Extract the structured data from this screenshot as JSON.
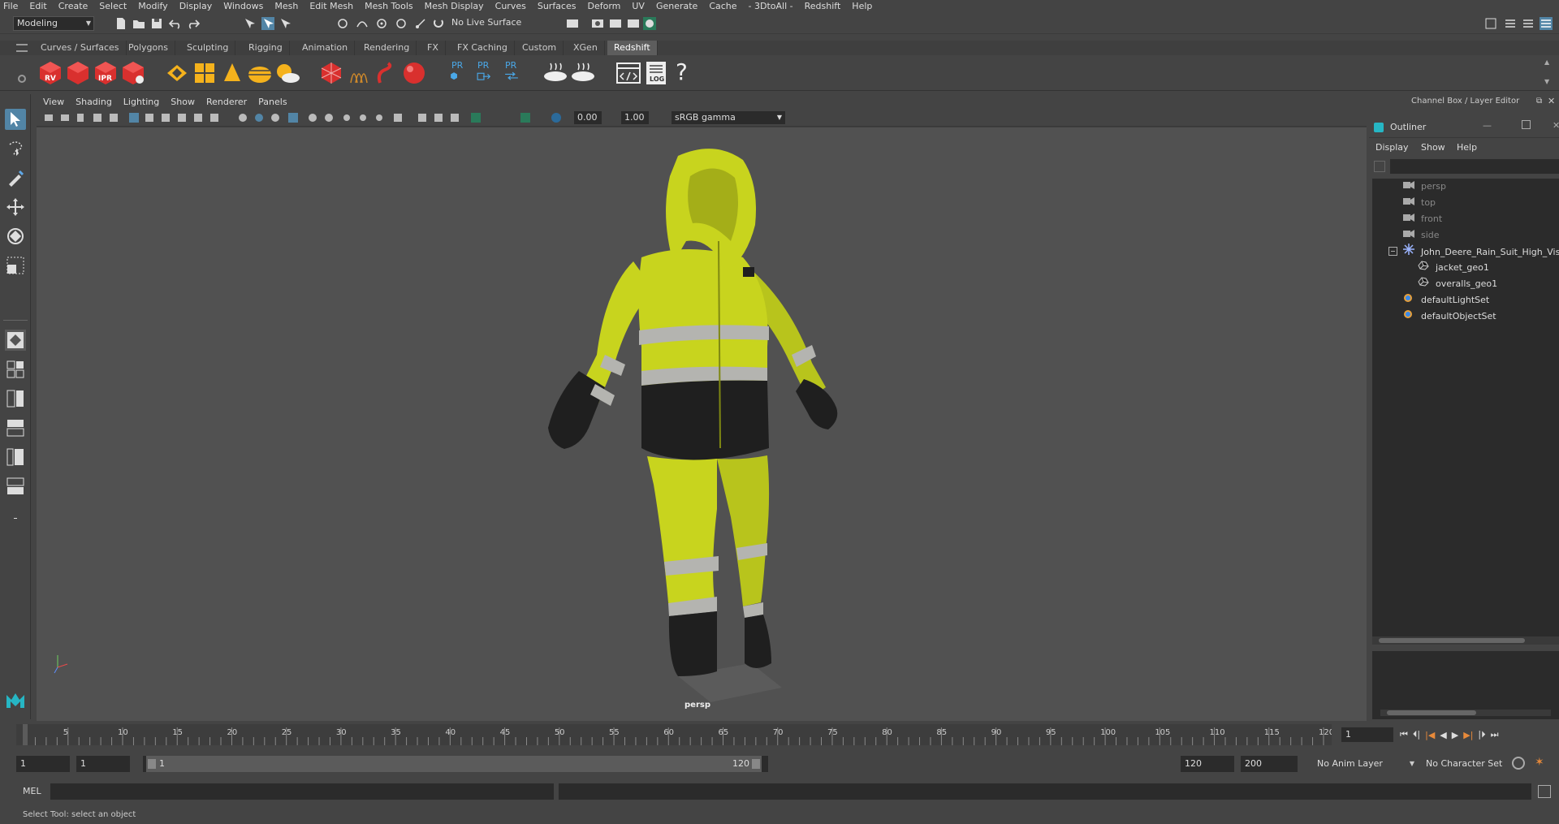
{
  "menubar": [
    "File",
    "Edit",
    "Create",
    "Select",
    "Modify",
    "Display",
    "Windows",
    "Mesh",
    "Edit Mesh",
    "Mesh Tools",
    "Mesh Display",
    "Curves",
    "Surfaces",
    "Deform",
    "UV",
    "Generate",
    "Cache",
    "- 3DtoAll -",
    "Redshift",
    "Help"
  ],
  "statusline": {
    "mode": "Modeling",
    "live_surface": "No Live Surface"
  },
  "shelf": {
    "tabs": [
      "Curves / Surfaces",
      "Polygons",
      "Sculpting",
      "Rigging",
      "Animation",
      "Rendering",
      "FX",
      "FX Caching",
      "Custom",
      "XGen",
      "Redshift"
    ],
    "active_tab": "Redshift",
    "icon_labels": {
      "rv": "RV",
      "ipr": "IPR",
      "log": "LOG",
      "help": "?",
      "pr1": "PR",
      "pr2": "PR",
      "pr3": "PR"
    }
  },
  "viewport": {
    "menu": [
      "View",
      "Shading",
      "Lighting",
      "Show",
      "Renderer",
      "Panels"
    ],
    "exposure": "0.00",
    "gamma": "1.00",
    "color_space": "sRGB gamma",
    "camera_label": "persp",
    "character_colors": {
      "hi_vis": "#c8d41e",
      "black": "#1f1f1f",
      "reflective": "#b4b4b0"
    }
  },
  "right_panel": {
    "header": "Channel Box / Layer Editor",
    "outliner_title": "Outliner",
    "outliner_menu": [
      "Display",
      "Show",
      "Help"
    ],
    "items": [
      {
        "label": "persp",
        "icon": "camera-icon",
        "dim": true,
        "indent": 1
      },
      {
        "label": "top",
        "icon": "camera-icon",
        "dim": true,
        "indent": 1
      },
      {
        "label": "front",
        "icon": "camera-icon",
        "dim": true,
        "indent": 1
      },
      {
        "label": "side",
        "icon": "camera-icon",
        "dim": true,
        "indent": 1
      },
      {
        "label": "John_Deere_Rain_Suit_High_Visib",
        "icon": "group-icon",
        "dim": false,
        "indent": 1
      },
      {
        "label": "jacket_geo1",
        "icon": "mesh-icon",
        "dim": false,
        "indent": 2
      },
      {
        "label": "overalls_geo1",
        "icon": "mesh-icon",
        "dim": false,
        "indent": 2
      },
      {
        "label": "defaultLightSet",
        "icon": "set-icon",
        "dim": false,
        "indent": 1
      },
      {
        "label": "defaultObjectSet",
        "icon": "set-icon",
        "dim": false,
        "indent": 1
      }
    ]
  },
  "timeline": {
    "ticks": [
      "5",
      "10",
      "15",
      "20",
      "25",
      "30",
      "35",
      "40",
      "45",
      "50",
      "55",
      "60",
      "65",
      "70",
      "75",
      "80",
      "85",
      "90",
      "95",
      "100",
      "105",
      "110",
      "115",
      "120"
    ],
    "first_label": "1",
    "current_frame": "1"
  },
  "range": {
    "start": "1",
    "playback_start": "1",
    "slider_start": "1",
    "slider_end": "120",
    "playback_end": "120",
    "end": "200",
    "anim_layer": "No Anim Layer",
    "character_set": "No Character Set"
  },
  "cmdline": {
    "lang": "MEL"
  },
  "helpline": {
    "text": "Select Tool: select an object"
  }
}
